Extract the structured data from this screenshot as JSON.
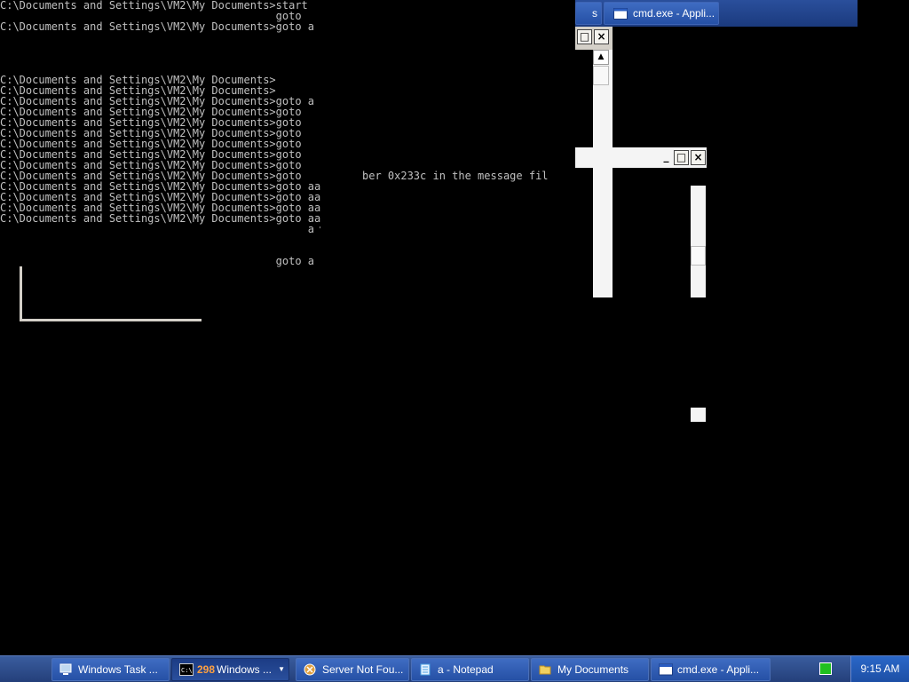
{
  "console": {
    "lines": [
      "C:\\Documents and Settings\\VM2\\My Documents>start",
      "                                           goto",
      "C:\\Documents and Settings\\VM2\\My Documents>goto a",
      "",
      "",
      "",
      "",
      "C:\\Documents and Settings\\VM2\\My Documents>",
      "C:\\Documents and Settings\\VM2\\My Documents>",
      "C:\\Documents and Settings\\VM2\\My Documents>goto a",
      "C:\\Documents and Settings\\VM2\\My Documents>goto",
      "C:\\Documents and Settings\\VM2\\My Documents>goto",
      "C:\\Documents and Settings\\VM2\\My Documents>goto",
      "C:\\Documents and Settings\\VM2\\My Documents>goto",
      "C:\\Documents and Settings\\VM2\\My Documents>goto",
      "C:\\Documents and Settings\\VM2\\My Documents>goto",
      "C:\\Documents and Settings\\VM2\\My Documents>goto",
      "C:\\Documents and Settings\\VM2\\My Documents>goto aa",
      "C:\\Documents and Settings\\VM2\\My Documents>goto aa",
      "C:\\Documents and Settings\\VM2\\My Documents>goto aa",
      "C:\\Documents and Settings\\VM2\\My Documents>goto aa",
      "                                                a",
      "",
      "",
      "                                           goto a"
    ],
    "error_fragment": "ber 0x233c in the message fil",
    "tick_fragment": "'"
  },
  "top_window_fragment": {
    "tab_text": "s",
    "cmd_label": "cmd.exe - Appli..."
  },
  "taskbar": {
    "buttons": [
      {
        "label": "Windows Task ...",
        "icon": "task-manager-icon"
      },
      {
        "label": "Windows ...",
        "badge": "298",
        "icon": "cmd-icon",
        "active": true
      },
      {
        "label": "Server Not Fou...",
        "icon": "browser-error-icon"
      },
      {
        "label": "a - Notepad",
        "icon": "notepad-icon"
      },
      {
        "label": "My Documents",
        "icon": "folder-icon"
      },
      {
        "label": "cmd.exe - Appli...",
        "icon": "window-icon"
      }
    ],
    "clock": "9:15 AM",
    "tray_icon": "task-manager-tray-icon"
  },
  "colors": {
    "console_text": "#c0c0c0",
    "console_bg": "#000000",
    "taskbar": "#2a4f9c",
    "clock_bg": "#1d5bc4"
  }
}
